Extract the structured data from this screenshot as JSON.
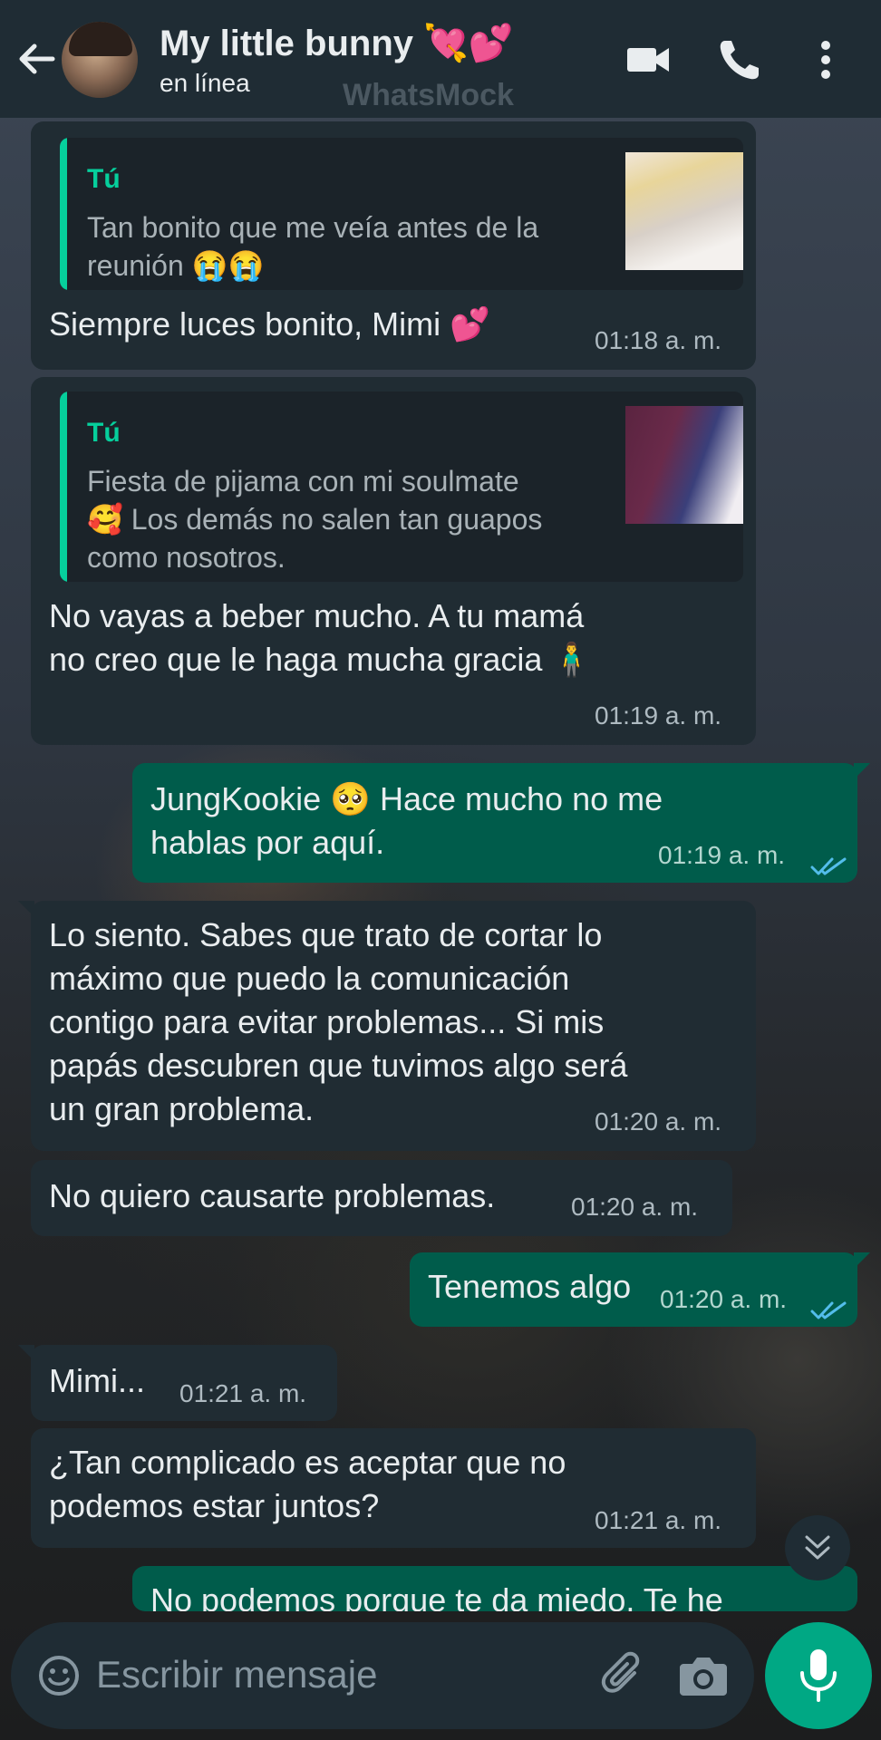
{
  "header": {
    "contact_name": "My little bunny",
    "contact_hearts": "💘💕",
    "status": "en línea",
    "watermark": "WhatsMock"
  },
  "icons": {
    "back": "arrow-left-icon",
    "video": "video-call-icon",
    "phone": "voice-call-icon",
    "menu": "more-vert-icon",
    "emoji": "emoji-icon",
    "attach": "paperclip-icon",
    "camera": "camera-icon",
    "mic": "microphone-icon",
    "scroll": "double-chevron-down-icon"
  },
  "colors": {
    "header_bg": "#1f2c34",
    "incoming_bubble": "#202c33",
    "outgoing_bubble": "#005c4b",
    "accent": "#00a884",
    "read_ticks": "#53bdeb"
  },
  "messages": [
    {
      "direction": "in",
      "quote_author": "Tú",
      "quote_lines": [
        "Tan bonito que me veía antes de la",
        "reunión 😭😭"
      ],
      "lines": [
        "Siempre luces bonito, Mimi 💕"
      ],
      "time": "01:18 a. m."
    },
    {
      "direction": "in",
      "quote_author": "Tú",
      "quote_lines": [
        "Fiesta de pijama con mi soulmate",
        "🥰 Los demás no salen tan guapos",
        "como nosotros."
      ],
      "lines": [
        "No vayas a beber mucho. A tu mamá",
        "no creo que le haga mucha gracia 🧍‍♂️"
      ],
      "time": "01:19 a. m."
    },
    {
      "direction": "out",
      "lines": [
        "JungKookie 🥺 Hace mucho no me",
        "hablas por aquí."
      ],
      "time": "01:19 a. m."
    },
    {
      "direction": "in",
      "lines": [
        "Lo siento. Sabes que trato de cortar lo",
        "máximo que puedo la comunicación",
        "contigo para evitar problemas... Si mis",
        "papás descubren que tuvimos algo será",
        "un gran problema."
      ],
      "time": "01:20 a. m."
    },
    {
      "direction": "in",
      "lines": [
        "No quiero causarte problemas."
      ],
      "time": "01:20 a. m."
    },
    {
      "direction": "out",
      "lines": [
        "Tenemos algo"
      ],
      "time": "01:20 a. m."
    },
    {
      "direction": "in",
      "lines": [
        "Mimi..."
      ],
      "time": "01:21 a. m."
    },
    {
      "direction": "in",
      "lines": [
        "¿Tan complicado es aceptar que no",
        "podemos estar juntos?"
      ],
      "time": "01:21 a. m."
    },
    {
      "direction": "out",
      "lines": [
        "No podemos porque te da miedo. Te he"
      ],
      "time": ""
    }
  ],
  "composer": {
    "placeholder": "Escribir mensaje"
  }
}
